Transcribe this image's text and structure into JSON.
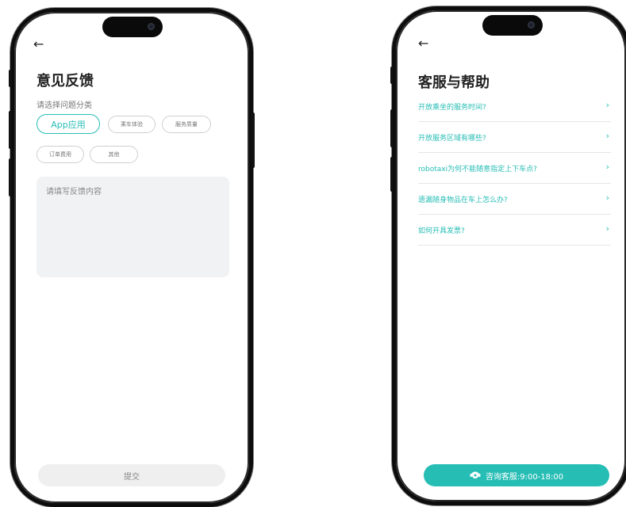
{
  "feedback": {
    "back_icon": "←",
    "title": "意见反馈",
    "category_prompt": "请选择问题分类",
    "categories": [
      {
        "label": "App应用",
        "selected": true
      },
      {
        "label": "乘车体验",
        "selected": false
      },
      {
        "label": "服务质量",
        "selected": false
      },
      {
        "label": "订单费用",
        "selected": false
      },
      {
        "label": "其他",
        "selected": false
      }
    ],
    "textarea_placeholder": "请填写反馈内容",
    "submit_label": "提交"
  },
  "help": {
    "back_icon": "←",
    "title": "客服与帮助",
    "faqs": [
      "开放乘坐的服务时间?",
      "开放服务区域有哪些?",
      "robotaxi为何不能随意指定上下车点?",
      "遗漏随身物品在车上怎么办?",
      "如何开具发票?"
    ],
    "chevron": "›",
    "consult_label": "咨询客服:9:00-18:00"
  },
  "colors": {
    "accent": "#26bdb5",
    "frame": "#0d0d0d",
    "input_bg": "#f1f2f4"
  },
  "icons": {
    "back": "arrow-left-icon",
    "chevron": "chevron-right-icon",
    "consult": "headset-icon"
  }
}
